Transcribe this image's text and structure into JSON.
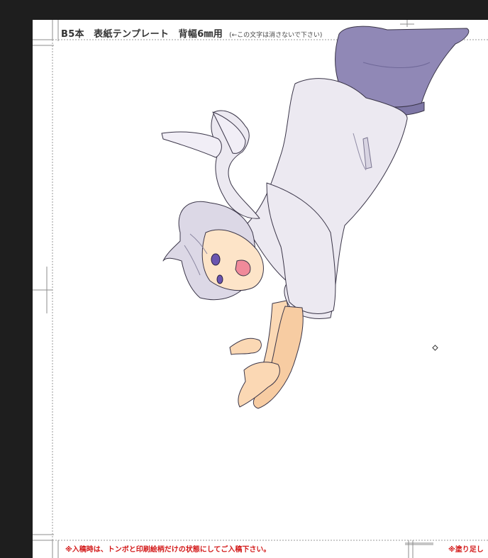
{
  "template": {
    "title": "B5本　表紙テンプレート　背幅6㎜用",
    "title_note": "(←この文字は消さないで下さい)",
    "bottom_note_left": "※入稿時は、トンボと印刷絵柄だけの状態にしてご入稿下さい。",
    "bottom_note_right": "※塗り足し"
  },
  "colors": {
    "workspace": "#1e1e1e",
    "page": "#ffffff",
    "guide": "#9a9a9a",
    "note_red": "#d31a1a",
    "pants": "#9088b6",
    "shirt": "#ece9f1",
    "skin": "#fbd8b4",
    "hair": "#dcd8e6"
  },
  "illustration": {
    "subject": "anime-boy-falling-illustration"
  }
}
